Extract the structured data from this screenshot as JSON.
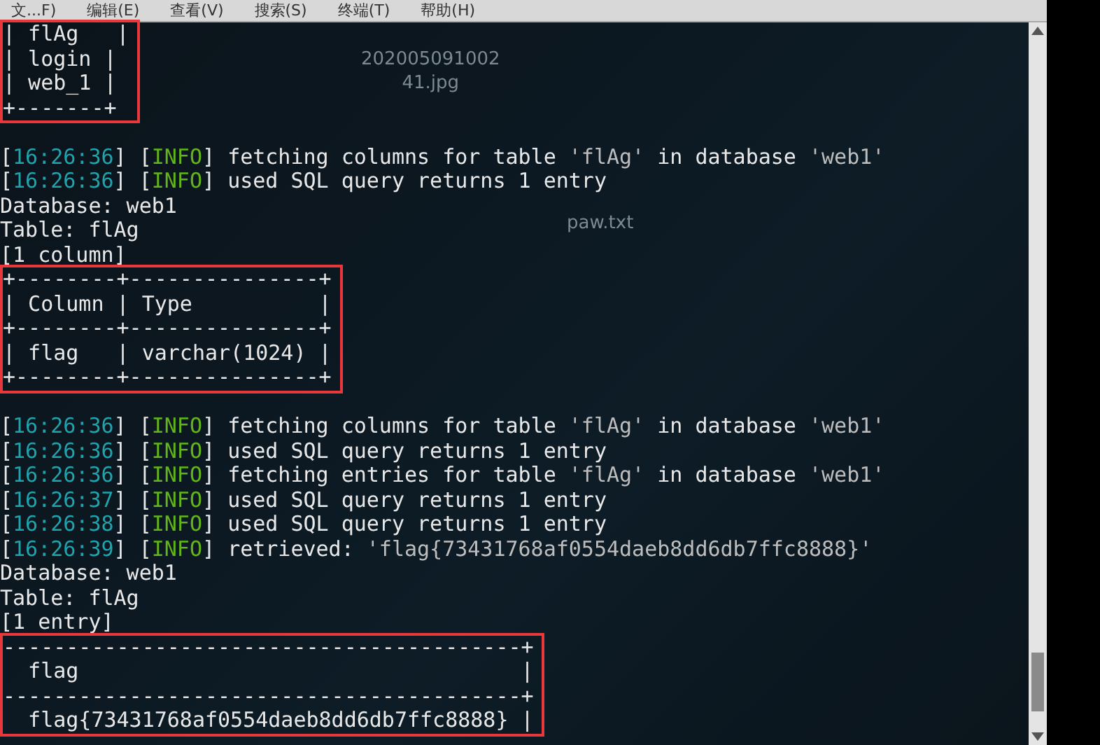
{
  "menu_bar": [
    "文...F)",
    "编辑(E)",
    "查看(V)",
    "搜索(S)",
    "终端(T)",
    "帮助(H)"
  ],
  "desktop_icons": [
    {
      "lines": [
        "202005091002",
        "41.jpg"
      ]
    },
    {
      "lines": [
        "paw.txt"
      ]
    }
  ],
  "terminal": [
    {
      "kind": "table",
      "highlighted": true,
      "lines": [
        "| flAg   |",
        "| login |",
        "| web_1 |",
        "+-------+"
      ]
    },
    {
      "kind": "blank"
    },
    {
      "kind": "log",
      "timestamp": "[16:26:36]",
      "level": "[INFO]",
      "message": "fetching columns for table 'flAg' in database 'web1'"
    },
    {
      "kind": "log",
      "timestamp": "[16:26:36]",
      "level": "[INFO]",
      "message": "used SQL query returns 1 entry"
    },
    {
      "kind": "text",
      "text": "Database: web1"
    },
    {
      "kind": "text",
      "text": "Table: flAg"
    },
    {
      "kind": "text",
      "text": "[1 column]"
    },
    {
      "kind": "table",
      "highlighted": true,
      "lines": [
        "+--------+---------------+",
        "| Column | Type          |",
        "+--------+---------------+",
        "| flag   | varchar(1024) |",
        "+--------+---------------+"
      ]
    },
    {
      "kind": "blank"
    },
    {
      "kind": "log",
      "timestamp": "[16:26:36]",
      "level": "[INFO]",
      "message": "fetching columns for table 'flAg' in database 'web1'"
    },
    {
      "kind": "log",
      "timestamp": "[16:26:36]",
      "level": "[INFO]",
      "message": "used SQL query returns 1 entry"
    },
    {
      "kind": "log",
      "timestamp": "[16:26:36]",
      "level": "[INFO]",
      "message": "fetching entries for table 'flAg' in database 'web1'"
    },
    {
      "kind": "log",
      "timestamp": "[16:26:37]",
      "level": "[INFO]",
      "message": "used SQL query returns 1 entry"
    },
    {
      "kind": "log",
      "timestamp": "[16:26:38]",
      "level": "[INFO]",
      "message": "used SQL query returns 1 entry"
    },
    {
      "kind": "log",
      "timestamp": "[16:26:39]",
      "level": "[INFO]",
      "message": "retrieved: 'flag{73431768af0554daeb8dd6db7ffc8888}'"
    },
    {
      "kind": "text",
      "text": "Database: web1"
    },
    {
      "kind": "text",
      "text": "Table: flAg"
    },
    {
      "kind": "text",
      "text": "[1 entry]"
    },
    {
      "kind": "table",
      "highlighted": true,
      "lines": [
        "-----------------------------------------+",
        "  flag                                   |",
        "-----------------------------------------+",
        "  flag{73431768af0554daeb8dd6db7ffc8888} |"
      ]
    }
  ]
}
